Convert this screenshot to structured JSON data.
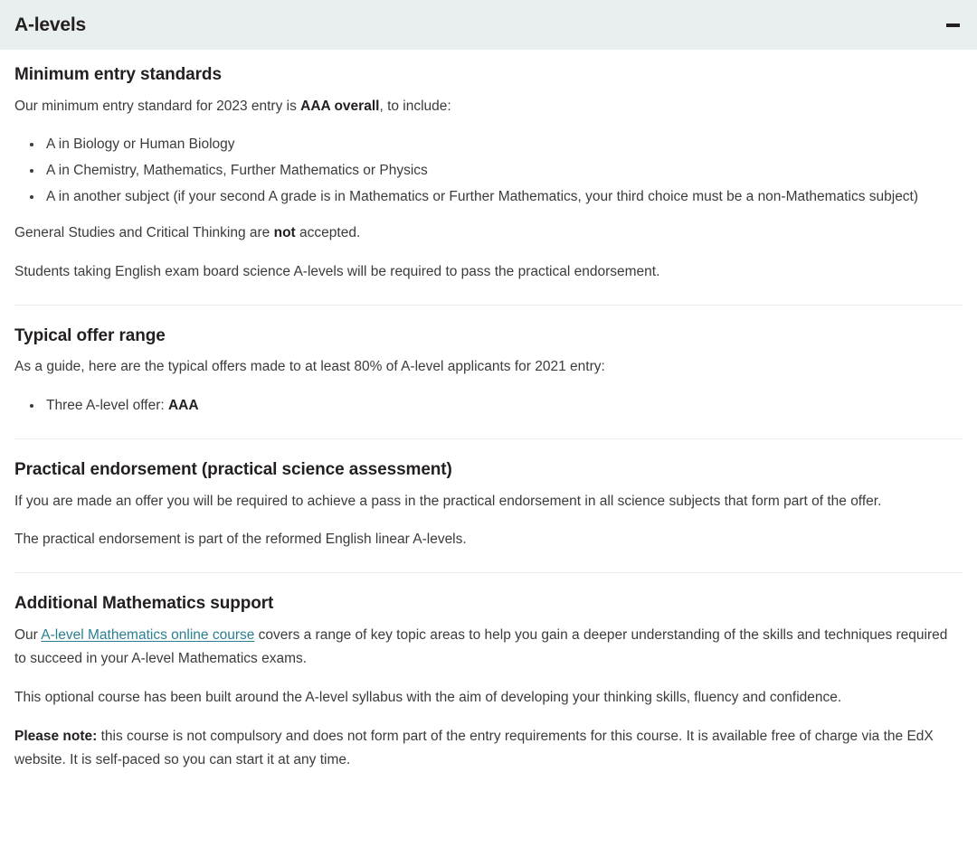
{
  "accordion": {
    "title": "A-levels",
    "toggle_icon": "minus-icon",
    "toggle_state": "expanded"
  },
  "colors": {
    "header_background": "#e9eeef",
    "heading_text": "#231f20",
    "body_text": "#3b3b3b",
    "link": "#2a7f93",
    "divider": "#eceeef",
    "page_background": "#ffffff"
  },
  "sections": [
    {
      "heading": "Minimum entry standards",
      "intro_before_bold": "Our minimum entry standard for 2023 entry is ",
      "intro_bold": "AAA overall",
      "intro_after_bold": ", to include:",
      "bullets": [
        "A in Biology or Human Biology",
        "A in Chemistry, Mathematics, Further Mathematics or Physics",
        "A in another subject (if your second A grade is in Mathematics or Further Mathematics, your third choice must be a non-Mathematics subject)"
      ],
      "note_before_bold": "General Studies and Critical Thinking are ",
      "note_bold": "not",
      "note_after_bold": " accepted.",
      "closing": "Students taking English exam board science A-levels will be required to pass the practical endorsement."
    },
    {
      "heading": "Typical offer range",
      "intro": "As a guide, here are the typical offers made to at least 80% of A-level applicants for 2021 entry:",
      "bullet_label": "Three A-level offer: ",
      "bullet_bold": "AAA"
    },
    {
      "heading": "Practical endorsement (practical science assessment)",
      "para1": "If you are made an offer you will be required to achieve a pass in the practical endorsement in all science subjects that form part of the offer.",
      "para2": "The practical endorsement is part of the reformed English linear A-levels."
    },
    {
      "heading": "Additional Mathematics support",
      "para1_before_link": "Our ",
      "para1_link": "A-level Mathematics online course",
      "para1_after_link": " covers a range of key topic areas to help you gain a deeper understanding of the skills and techniques required to succeed in your A-level Mathematics exams.",
      "para2": "This optional course has been built around the A-level syllabus with the aim of developing your thinking skills, fluency and confidence.",
      "para3_bold": "Please note:",
      "para3_rest": " this course is not compulsory and does not form part of the entry requirements for this course. It is available free of charge via the EdX website. It is self-paced so you can start it at any time."
    }
  ]
}
